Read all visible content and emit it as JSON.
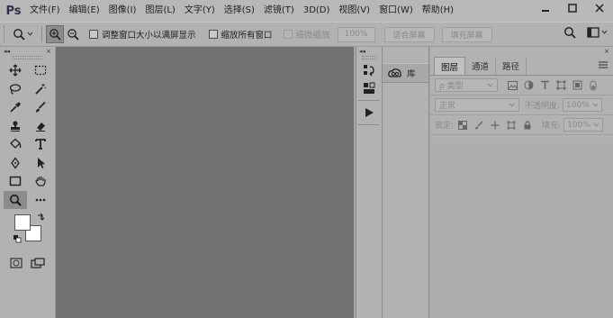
{
  "app": {
    "logo": "Ps"
  },
  "menu": [
    "文件(F)",
    "编辑(E)",
    "图像(I)",
    "图层(L)",
    "文字(Y)",
    "选择(S)",
    "滤镜(T)",
    "3D(D)",
    "视图(V)",
    "窗口(W)",
    "帮助(H)"
  ],
  "options": {
    "resize_windows_label": "调整窗口大小以满屏显示",
    "zoom_all_label": "缩放所有窗口",
    "scrubby_zoom_label": "细微缩放",
    "zoom_100_label": "100%",
    "fit_screen_label": "适合屏幕",
    "fill_screen_label": "填充屏幕"
  },
  "tools_panel": {
    "collapse": "◂◂",
    "close": "×",
    "foreground_color": "#ffffff",
    "background_color": "#ffffff"
  },
  "library": {
    "label": "库"
  },
  "layers_panel": {
    "tabs": [
      "图层",
      "通道",
      "路径"
    ],
    "filter_label": "ρ 类型",
    "blend_mode": "正常",
    "opacity_label": "不透明度:",
    "opacity_value": "100%",
    "lock_label": "锁定:",
    "fill_label": "填充:",
    "fill_value": "100%"
  },
  "colors": {
    "menubar_bg": "#b8b8b8",
    "panel_bg": "#b2b2b2",
    "canvas_bg": "#727272",
    "logo_color": "#31304f"
  }
}
